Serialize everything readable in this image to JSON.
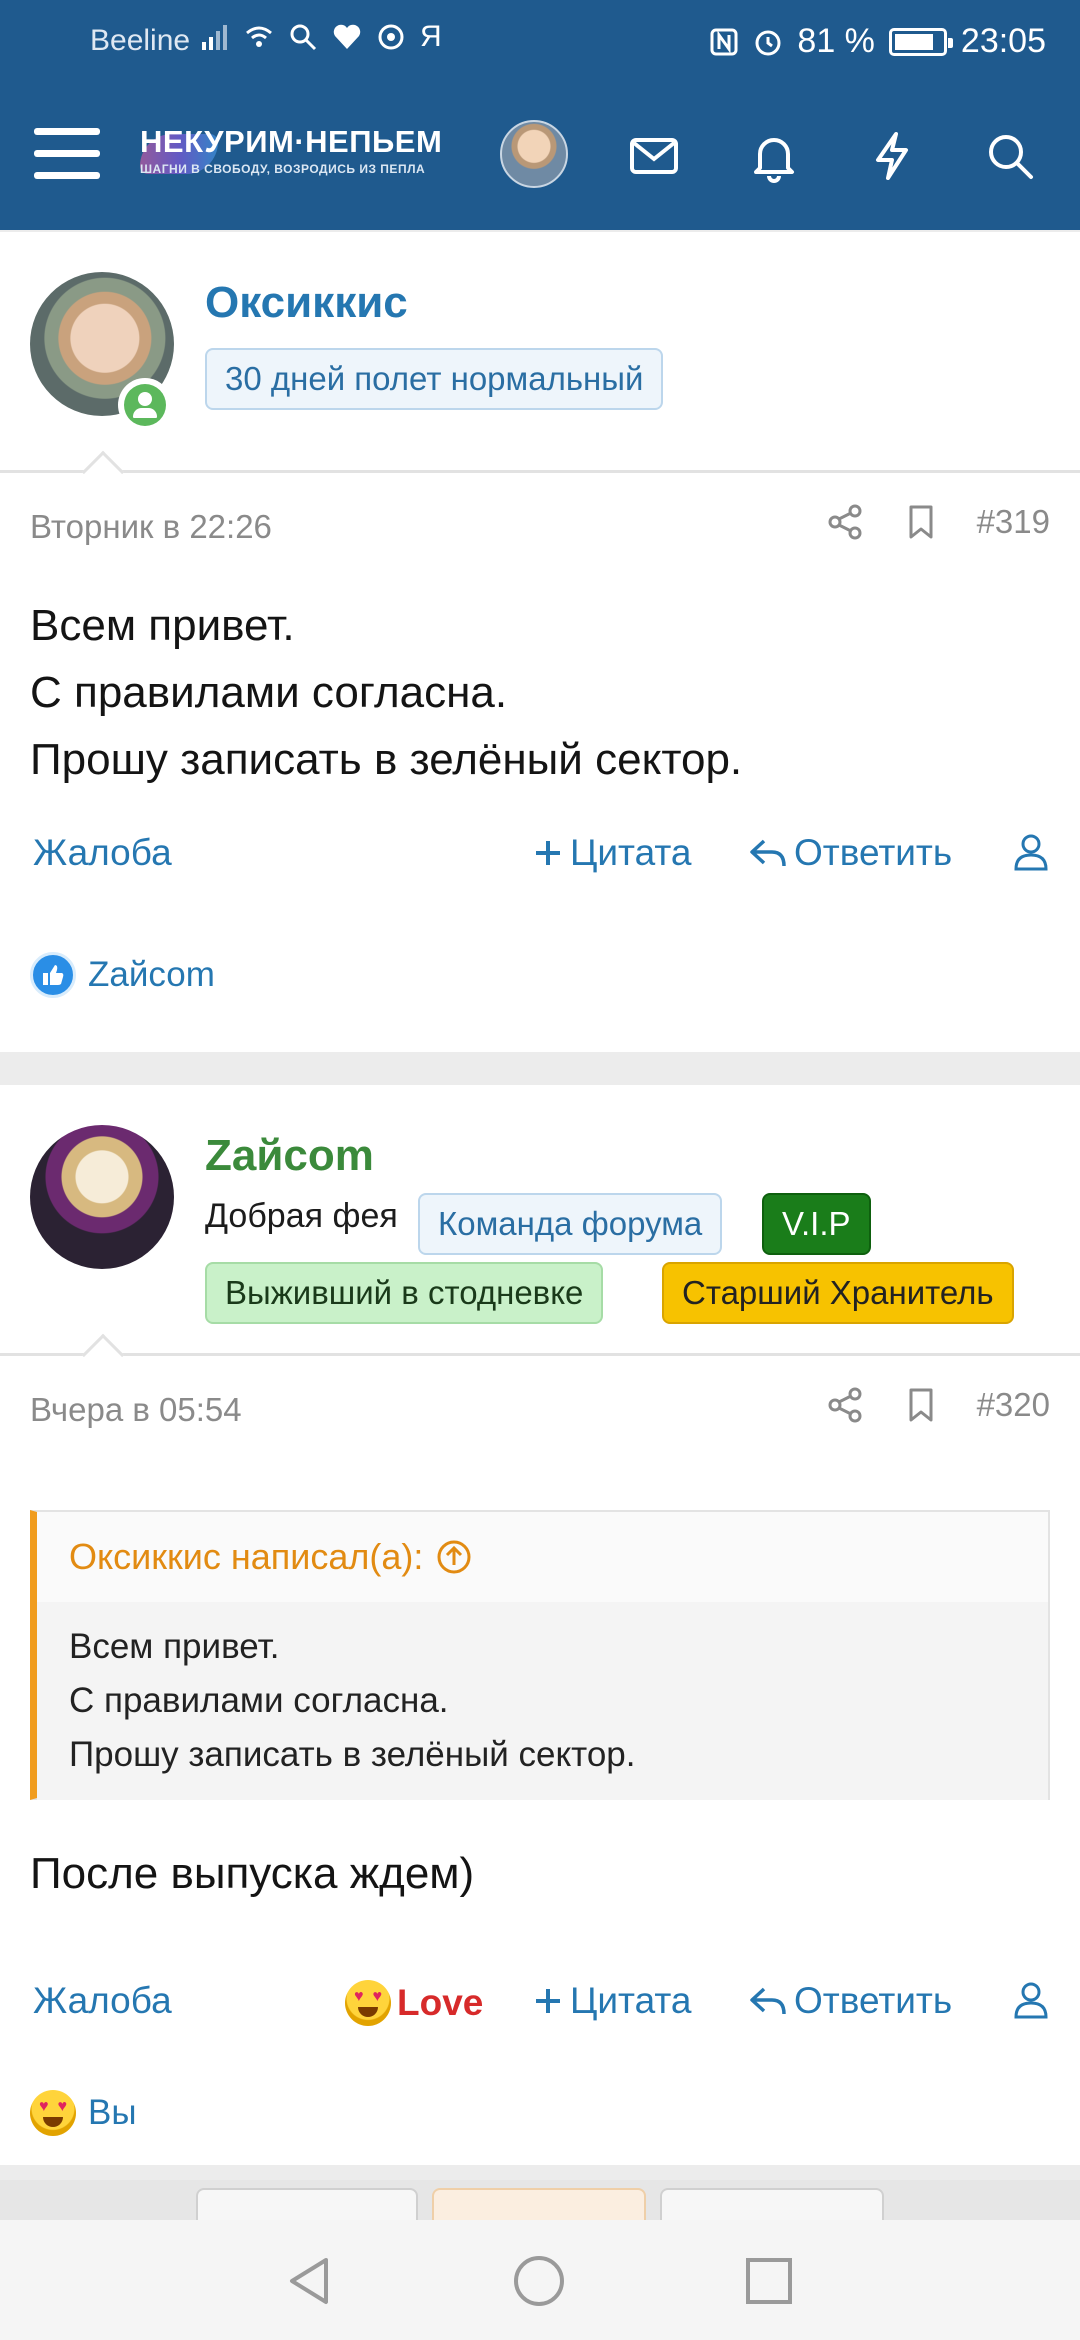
{
  "status_bar": {
    "carrier": "Beeline",
    "battery": "81 %",
    "time": "23:05",
    "ya": "Я"
  },
  "header": {
    "logo_title": "НЕКУРИМ·НЕПЬЕМ",
    "logo_tagline": "ШАГНИ В СВОБОДУ, ВОЗРОДИСЬ ИЗ ПЕПЛА"
  },
  "posts": [
    {
      "username": "Оксиккис",
      "user_title": "30 дней полет нормальный",
      "date": "Вторник в 22:26",
      "number": "#319",
      "lines": [
        "Всем привет.",
        "С правилами согласна.",
        "Прошу записать в зелёный сектор."
      ],
      "actions": {
        "report": "Жалоба",
        "quote": "Цитата",
        "reply": "Ответить"
      },
      "reactions": "Zайсоm"
    },
    {
      "username": "Zайсоm",
      "user_title": "Добрая фея",
      "banners": [
        "Команда форума",
        "V.I.P",
        "Выживший в стодневке",
        "Старший Хранитель"
      ],
      "date": "Вчера в 05:54",
      "number": "#320",
      "quote_author": "Оксиккис написал(а):",
      "quote_lines": [
        "Всем привет.",
        "С правилами согласна.",
        "Прошу записать в зелёный сектор."
      ],
      "lines": [
        "После выпуска ждем)"
      ],
      "actions": {
        "report": "Жалоба",
        "love": "Love",
        "quote": "Цитата",
        "reply": "Ответить"
      },
      "reactions": "Вы"
    }
  ],
  "colors": {
    "header": "#1f5a8e",
    "link": "#2577b1",
    "quote_accent": "#f09c1e",
    "love": "#d72a2a"
  },
  "icons": [
    "menu-icon",
    "mail-icon",
    "bell-icon",
    "lightning-icon",
    "search-icon",
    "share-icon",
    "bookmark-icon",
    "user-icon",
    "plus-icon",
    "reply-icon",
    "thumbs-up-icon",
    "love-emoji-icon",
    "arrow-up-circle-icon",
    "back-icon",
    "home-icon",
    "recents-icon"
  ]
}
